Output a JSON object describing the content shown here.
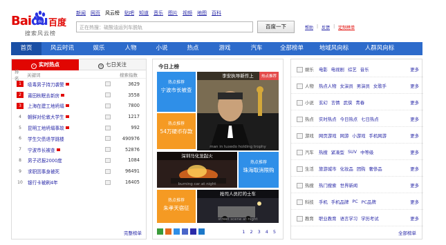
{
  "logo": {
    "word_red": "Bai",
    "word_blue": "du",
    "cn": "百度",
    "sub": "搜索风云榜"
  },
  "top_nav": [
    "新闻",
    "网页",
    "风云榜",
    "贴吧",
    "知道",
    "音乐",
    "图片",
    "视频",
    "地图",
    "百科"
  ],
  "search": {
    "placeholder": "正在热搜：硫酸油运列车脱轨",
    "button": "百度一下"
  },
  "util_links": {
    "help": "帮助",
    "feedback": "反馈",
    "customize": "定制榜单"
  },
  "main_nav": [
    "首页",
    "风云时讯",
    "娱乐",
    "人物",
    "小说",
    "热点",
    "游戏",
    "汽车",
    "全部榜单",
    "地域风向标",
    "人群风向标"
  ],
  "left": {
    "tab_realtime": "实时热点",
    "tab_week": "七日关注",
    "head": {
      "rank": "排名",
      "keyword": "关键词",
      "index": "搜索指数"
    },
    "rows": [
      {
        "rank": "1",
        "kw": "吸毒男子持刀袭警",
        "num": "3629"
      },
      {
        "rank": "2",
        "kw": "莆田秋眠去新房",
        "num": "3558"
      },
      {
        "rank": "3",
        "kw": "上海在建工地坍塌",
        "num": "7800"
      },
      {
        "rank": "4",
        "kw": "朝鲜对伦敦大学生",
        "num": "1217"
      },
      {
        "rank": "5",
        "kw": "昆明工地坍塌事故",
        "num": "992"
      },
      {
        "rank": "6",
        "kw": "学生欠债退学跳楼",
        "num": "490976"
      },
      {
        "rank": "7",
        "kw": "宁波市长被查",
        "num": "52876"
      },
      {
        "rank": "8",
        "kw": "男子迟报2000度",
        "num": "1084"
      },
      {
        "rank": "9",
        "kw": "求职因事身被死",
        "num": "96491"
      },
      {
        "rank": "10",
        "kw": "银行卡被刷4年",
        "num": "16405"
      }
    ],
    "more": "完整榜单"
  },
  "mid": {
    "title": "今日上榜",
    "tile1": {
      "label": "热点推荐",
      "title": "宁波市长被查"
    },
    "photo_main": {
      "caption": "李安执导新作上",
      "tag": "热点推荐",
      "subject": "man in tuxedo holding trophy"
    },
    "tile2": {
      "label": "热点推荐",
      "title": "54万硬币存款"
    },
    "photo2": {
      "caption": "深圳马化龙起火",
      "subject": "burning car at night"
    },
    "tile3": {
      "label": "热点推荐",
      "title": "珠海取消限购"
    },
    "tile4": {
      "label": "热点推荐",
      "title": "朱孝天宿征"
    },
    "photo3": {
      "caption": "抢司人员打的士车",
      "subject": "street scene at night"
    },
    "pages": [
      "1",
      "2",
      "3",
      "4",
      "5"
    ]
  },
  "right": {
    "cats": [
      {
        "name": "娱乐",
        "links": [
          "电影",
          "电视剧",
          "综艺",
          "音乐"
        ],
        "more": "更多"
      },
      {
        "name": "人物",
        "links": [
          "热点人物",
          "女演员",
          "男演员",
          "女歌手"
        ],
        "more": "更多"
      },
      {
        "name": "小说",
        "links": [
          "玄幻",
          "言情",
          "武侠",
          "青春"
        ],
        "more": "更多"
      },
      {
        "name": "热点",
        "links": [
          "实时热点",
          "今日热点",
          "七日热点"
        ],
        "more": "更多"
      },
      {
        "name": "游戏",
        "links": [
          "网页游戏",
          "网游",
          "小游戏",
          "手机网游"
        ],
        "more": "更多"
      },
      {
        "name": "汽车",
        "links": [
          "热搜",
          "紧凑型",
          "SUV",
          "中等级"
        ],
        "more": "更多"
      },
      {
        "name": "生活",
        "links": [
          "旅游城市",
          "化妆品",
          "团购",
          "奢侈品"
        ],
        "more": "更多"
      },
      {
        "name": "热搜",
        "links": [
          "热门搜索",
          "世界新闻"
        ],
        "more": "更多"
      },
      {
        "name": "科技",
        "links": [
          "手机",
          "手机品牌",
          "PC",
          "PC品牌"
        ],
        "more": "更多"
      },
      {
        "name": "教育",
        "links": [
          "职业教育",
          "语言学习",
          "学历考试"
        ],
        "more": "更多"
      }
    ],
    "all": "全部榜单"
  },
  "colors": {
    "brand_red": "#e10602",
    "brand_blue": "#2932e1",
    "nav_blue": "#2d6bcb",
    "tile_blue": "#2f8fe8",
    "tile_orange": "#f59a23"
  }
}
